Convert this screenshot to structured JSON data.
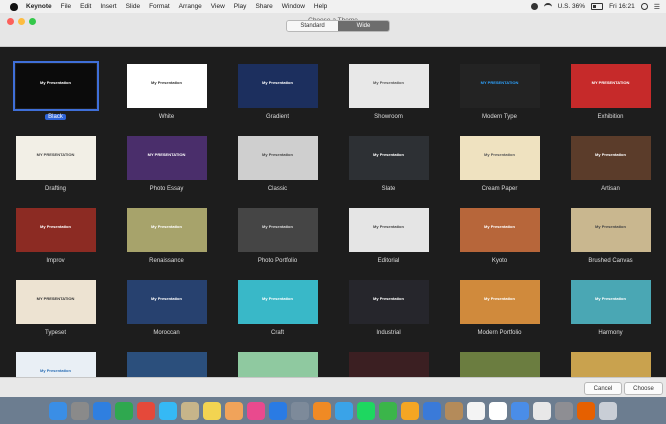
{
  "menubar": {
    "items": [
      "Keynote",
      "File",
      "Edit",
      "Insert",
      "Slide",
      "Format",
      "Arrange",
      "View",
      "Play",
      "Share",
      "Window",
      "Help"
    ],
    "status_text": "U.S.  36%",
    "clock": "Fri 16:21"
  },
  "window": {
    "title": "Choose a Theme",
    "segments": {
      "standard": "Standard",
      "wide": "Wide"
    },
    "selected_segment": "Wide"
  },
  "themes": [
    {
      "name": "Black",
      "thumb_text": "My Presentation",
      "bg": "#0b0b0b",
      "fg": "#ffffff",
      "selected": true
    },
    {
      "name": "White",
      "thumb_text": "My Presentation",
      "bg": "#ffffff",
      "fg": "#333333",
      "selected": false
    },
    {
      "name": "Gradient",
      "thumb_text": "My Presentation",
      "bg": "#1c2f5e",
      "fg": "#ffffff",
      "selected": false
    },
    {
      "name": "Showroom",
      "thumb_text": "My Presentation",
      "bg": "#e8e8e8",
      "fg": "#555555",
      "selected": false
    },
    {
      "name": "Modern Type",
      "thumb_text": "MY PRESENTATION",
      "bg": "#232323",
      "fg": "#2ea3ff",
      "selected": false
    },
    {
      "name": "Exhibition",
      "thumb_text": "MY PRESENTATION",
      "bg": "#c62a2a",
      "fg": "#ffffff",
      "selected": false
    },
    {
      "name": "Drafting",
      "thumb_text": "MY PRESENTATION",
      "bg": "#f2efe6",
      "fg": "#444444",
      "selected": false
    },
    {
      "name": "Photo Essay",
      "thumb_text": "MY PRESENTATION",
      "bg": "#4a2e6b",
      "fg": "#ffffff",
      "selected": false
    },
    {
      "name": "Classic",
      "thumb_text": "My Presentation",
      "bg": "#cfcfcf",
      "fg": "#444444",
      "selected": false
    },
    {
      "name": "Slate",
      "thumb_text": "My Presentation",
      "bg": "#2d3034",
      "fg": "#ffffff",
      "selected": false
    },
    {
      "name": "Cream Paper",
      "thumb_text": "My Presentation",
      "bg": "#efe2c0",
      "fg": "#555555",
      "selected": false
    },
    {
      "name": "Artisan",
      "thumb_text": "My Presentation",
      "bg": "#5b3c2a",
      "fg": "#ffffff",
      "selected": false
    },
    {
      "name": "Improv",
      "thumb_text": "My Presentation",
      "bg": "#8c2b23",
      "fg": "#ffffff",
      "selected": false
    },
    {
      "name": "Renaissance",
      "thumb_text": "My Presentation",
      "bg": "#a7a36b",
      "fg": "#ffffff",
      "selected": false
    },
    {
      "name": "Photo Portfolio",
      "thumb_text": "My Presentation",
      "bg": "#454545",
      "fg": "#dddddd",
      "selected": false
    },
    {
      "name": "Editorial",
      "thumb_text": "My Presentation",
      "bg": "#e5e5e5",
      "fg": "#444444",
      "selected": false
    },
    {
      "name": "Kyoto",
      "thumb_text": "My Presentation",
      "bg": "#b7663a",
      "fg": "#ffffff",
      "selected": false
    },
    {
      "name": "Brushed Canvas",
      "thumb_text": "My Presentation",
      "bg": "#c9b78f",
      "fg": "#444444",
      "selected": false
    },
    {
      "name": "Typeset",
      "thumb_text": "MY PRESENTATION",
      "bg": "#ede3d2",
      "fg": "#333333",
      "selected": false
    },
    {
      "name": "Moroccan",
      "thumb_text": "My Presentation",
      "bg": "#27416f",
      "fg": "#ffffff",
      "selected": false
    },
    {
      "name": "Craft",
      "thumb_text": "My Presentation",
      "bg": "#39b8c8",
      "fg": "#ffffff",
      "selected": false
    },
    {
      "name": "Industrial",
      "thumb_text": "My Presentation",
      "bg": "#26262c",
      "fg": "#ffffff",
      "selected": false
    },
    {
      "name": "Modern Portfolio",
      "thumb_text": "My Presentation",
      "bg": "#d08a3c",
      "fg": "#ffffff",
      "selected": false
    },
    {
      "name": "Harmony",
      "thumb_text": "My Presentation",
      "bg": "#4aa7b4",
      "fg": "#ffffff",
      "selected": false
    },
    {
      "name": "",
      "thumb_text": "My Presentation",
      "bg": "#e9eff5",
      "fg": "#2c6fb5",
      "selected": false
    },
    {
      "name": "",
      "thumb_text": "",
      "bg": "#2b4f7c",
      "fg": "#ffffff",
      "selected": false
    },
    {
      "name": "",
      "thumb_text": "",
      "bg": "#8fc9a0",
      "fg": "#ffffff",
      "selected": false
    },
    {
      "name": "",
      "thumb_text": "",
      "bg": "#3b1f22",
      "fg": "#ffffff",
      "selected": false
    },
    {
      "name": "",
      "thumb_text": "",
      "bg": "#6b7d40",
      "fg": "#ffffff",
      "selected": false
    },
    {
      "name": "",
      "thumb_text": "",
      "bg": "#c9a24e",
      "fg": "#ffffff",
      "selected": false
    }
  ],
  "footer": {
    "cancel": "Cancel",
    "choose": "Choose"
  },
  "dock": {
    "apps": [
      {
        "icon": "finder-icon",
        "color": "#3a8ee6"
      },
      {
        "icon": "launchpad-icon",
        "color": "#8a8a8a"
      },
      {
        "icon": "safari-icon",
        "color": "#2f7fe0"
      },
      {
        "icon": "facetime-icon",
        "color": "#2fa84f"
      },
      {
        "icon": "chrome-icon",
        "color": "#e5493a"
      },
      {
        "icon": "messages-icon",
        "color": "#35b9f5"
      },
      {
        "icon": "preview-icon",
        "color": "#c7b58a"
      },
      {
        "icon": "notes-icon",
        "color": "#f3d451"
      },
      {
        "icon": "photos-icon",
        "color": "#f0a35a"
      },
      {
        "icon": "itunes-icon",
        "color": "#e94a8e"
      },
      {
        "icon": "app-store-icon",
        "color": "#2a7be4"
      },
      {
        "icon": "photo-stream-icon",
        "color": "#7d8a9a"
      },
      {
        "icon": "ibooks-icon",
        "color": "#f08a24"
      },
      {
        "icon": "twitter-icon",
        "color": "#3aa3e8"
      },
      {
        "icon": "spotify-icon",
        "color": "#1ed760"
      },
      {
        "icon": "numbers-icon",
        "color": "#3bb54a"
      },
      {
        "icon": "pages-icon",
        "color": "#f5a623"
      },
      {
        "icon": "keynote-icon",
        "color": "#3a7ad9"
      },
      {
        "icon": "contacts-icon",
        "color": "#b48b5a"
      },
      {
        "icon": "calendar-icon",
        "color": "#f4f4f4"
      },
      {
        "icon": "reminders-icon",
        "color": "#ffffff"
      },
      {
        "icon": "keynote-presentation-icon",
        "color": "#4a8de8"
      },
      {
        "icon": "textedit-icon",
        "color": "#e8e8e8"
      },
      {
        "icon": "system-preferences-icon",
        "color": "#8e8e93"
      },
      {
        "icon": "firefox-icon",
        "color": "#e66000"
      },
      {
        "icon": "trash-icon",
        "color": "#c9ced6"
      }
    ]
  }
}
